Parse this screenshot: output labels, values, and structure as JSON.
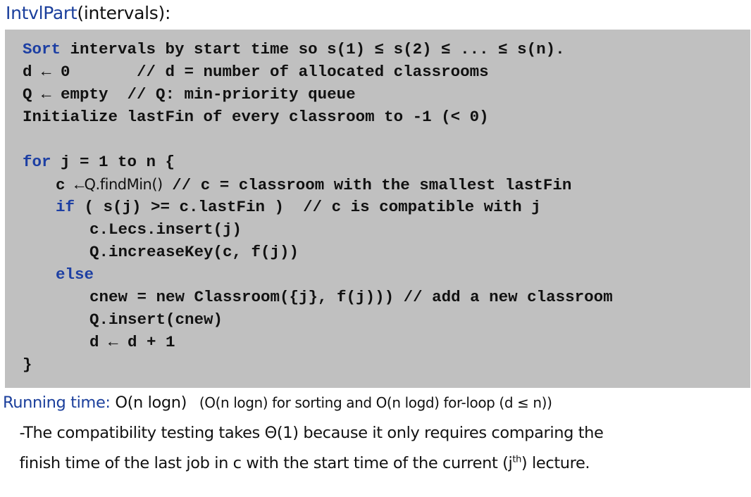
{
  "title": {
    "name": "IntvlPart",
    "params": "(intervals):"
  },
  "code": {
    "lines": [
      {
        "kw": "Sort",
        "rest": " intervals by start time so s(1) ≤ s(2) ≤ ... ≤ s(n)."
      },
      {
        "kw": "",
        "rest": "d ← 0       // d = number of allocated classrooms"
      },
      {
        "kw": "",
        "rest": "Q ← empty  // Q: min-priority queue"
      },
      {
        "kw": "",
        "rest": "Initialize lastFin of every classroom to -1 (< 0)"
      },
      {
        "kw": "for",
        "rest": " j = 1 to n {"
      },
      {
        "pre": "c ←",
        "sans": "Q.findMin()",
        "rest": " // c = classroom with the smallest lastFin"
      },
      {
        "kw": "if",
        "rest": " ( s(j) >= c.lastFin )  // c is compatible with j"
      },
      {
        "kw": "",
        "rest": "c.Lecs.insert(j)"
      },
      {
        "kw": "",
        "rest": "Q.increaseKey(c, f(j))"
      },
      {
        "kw": "else",
        "rest": ""
      },
      {
        "kw": "",
        "rest": "cnew = new Classroom({j}, f(j))) // add a new classroom"
      },
      {
        "kw": "",
        "rest": "Q.insert(cnew)"
      },
      {
        "kw": "",
        "rest": "d ← d + 1"
      },
      {
        "kw": "",
        "rest": "}"
      }
    ]
  },
  "footer": {
    "label": "Running time:",
    "complexity": " O(n logn)",
    "detail": "   (O(n logn) for sorting and O(n logd) for-loop (d ≤ n))",
    "line2": "  -The compatibility testing takes Θ(1) because it only requires comparing the",
    "line3_pre": "  finish time of the last job in c with the start time of the current (j",
    "line3_sup": "th",
    "line3_post": ") lecture."
  }
}
